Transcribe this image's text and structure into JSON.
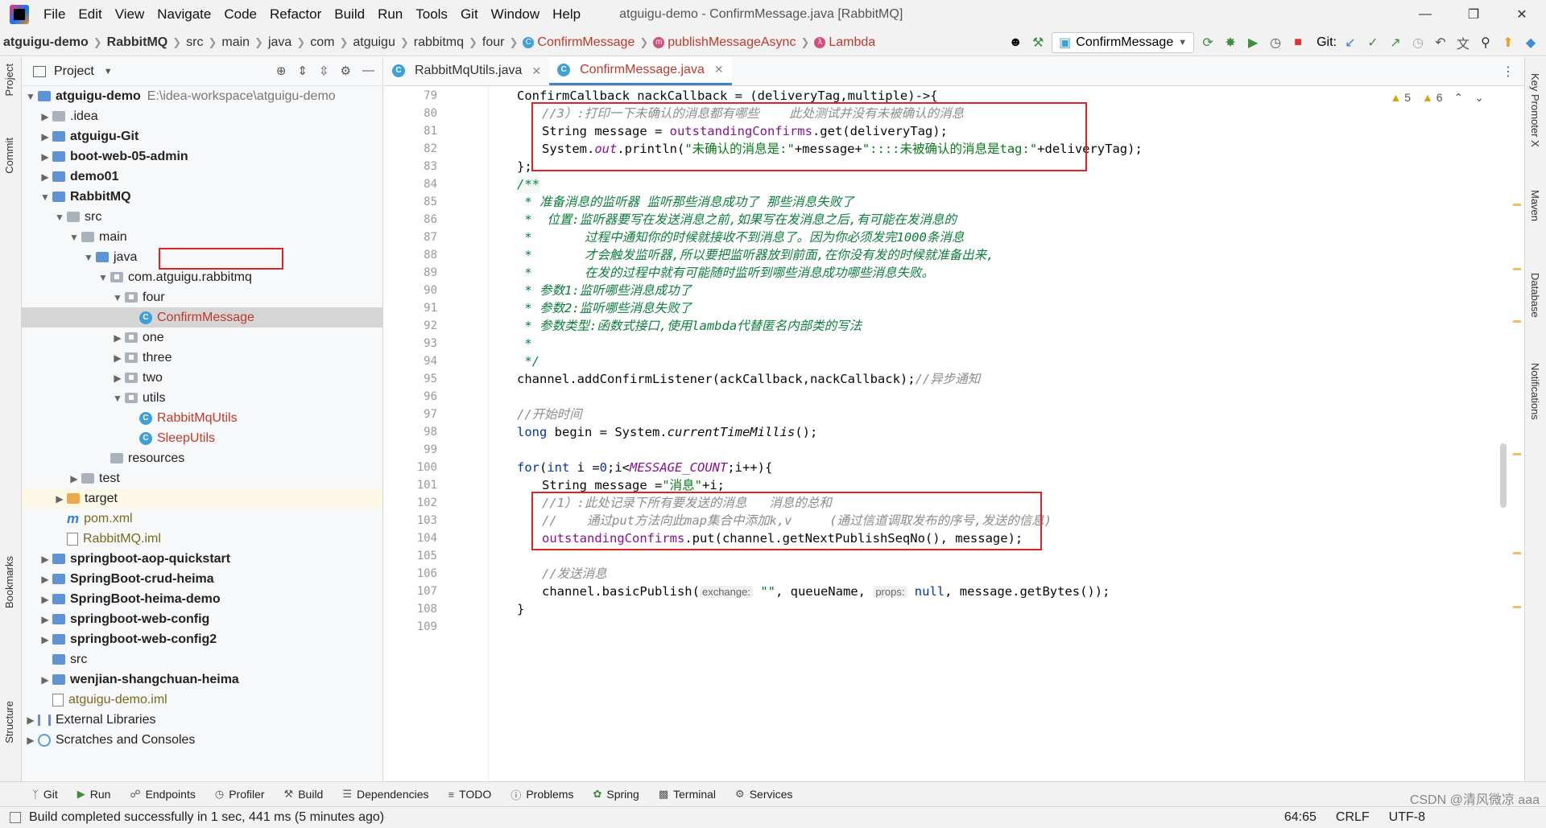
{
  "menubar": {
    "items": [
      "File",
      "Edit",
      "View",
      "Navigate",
      "Code",
      "Refactor",
      "Build",
      "Run",
      "Tools",
      "Git",
      "Window",
      "Help"
    ],
    "title": "atguigu-demo - ConfirmMessage.java [RabbitMQ]"
  },
  "navbar": {
    "crumbs": [
      "atguigu-demo",
      "RabbitMQ",
      "src",
      "main",
      "java",
      "com",
      "atguigu",
      "rabbitmq",
      "four",
      "ConfirmMessage",
      "publishMessageAsync",
      "Lambda"
    ],
    "run_config": "ConfirmMessage",
    "git_label": "Git:"
  },
  "left_strip": {
    "project": "Project",
    "commit": "Commit",
    "bookmarks": "Bookmarks",
    "structure": "Structure"
  },
  "right_strip": {
    "key_promoter": "Key Promoter X",
    "maven": "Maven",
    "database": "Database",
    "notifications": "Notifications"
  },
  "project_panel": {
    "title": "Project",
    "tree": [
      {
        "label": "atguigu-demo",
        "extra": "E:\\idea-workspace\\atguigu-demo"
      },
      {
        "label": ".idea"
      },
      {
        "label": "atguigu-Git"
      },
      {
        "label": "boot-web-05-admin"
      },
      {
        "label": "demo01"
      },
      {
        "label": "RabbitMQ"
      },
      {
        "label": "src"
      },
      {
        "label": "main"
      },
      {
        "label": "java"
      },
      {
        "label": "com.atguigu.rabbitmq"
      },
      {
        "label": "four"
      },
      {
        "label": "ConfirmMessage"
      },
      {
        "label": "one"
      },
      {
        "label": "three"
      },
      {
        "label": "two"
      },
      {
        "label": "utils"
      },
      {
        "label": "RabbitMqUtils"
      },
      {
        "label": "SleepUtils"
      },
      {
        "label": "resources"
      },
      {
        "label": "test"
      },
      {
        "label": "target"
      },
      {
        "label": "pom.xml"
      },
      {
        "label": "RabbitMQ.iml"
      },
      {
        "label": "springboot-aop-quickstart"
      },
      {
        "label": "SpringBoot-crud-heima"
      },
      {
        "label": "SpringBoot-heima-demo"
      },
      {
        "label": "springboot-web-config"
      },
      {
        "label": "springboot-web-config2"
      },
      {
        "label": "src"
      },
      {
        "label": "wenjian-shangchuan-heima"
      },
      {
        "label": "atguigu-demo.iml"
      },
      {
        "label": "External Libraries"
      },
      {
        "label": "Scratches and Consoles"
      }
    ]
  },
  "editor": {
    "tabs": [
      "RabbitMqUtils.java",
      "ConfirmMessage.java"
    ],
    "inspections": {
      "warnings": "5",
      "weak": "6"
    },
    "line_numbers": [
      "79",
      "80",
      "81",
      "82",
      "83",
      "84",
      "85",
      "86",
      "87",
      "88",
      "89",
      "90",
      "91",
      "92",
      "93",
      "94",
      "95",
      "96",
      "97",
      "98",
      "99",
      "100",
      "101",
      "102",
      "103",
      "104",
      "105",
      "106",
      "107",
      "108",
      "109"
    ],
    "code": {
      "l79_a": "ConfirmCallback nackCallback = (deliveryTag,multiple)->{",
      "l80": "//3）:打印一下未确认的消息都有哪些    此处测试并没有未被确认的消息",
      "l81_a": "String message = ",
      "l81_b": "outstandingConfirms",
      "l81_c": ".get(deliveryTag);",
      "l82_a": "System.",
      "l82_b": "out",
      "l82_c": ".println(",
      "l82_d": "\"未确认的消息是:\"",
      "l82_e": "+message+",
      "l82_f": "\"::::未被确认的消息是tag:\"",
      "l82_g": "+deliveryTag);",
      "l83": "};",
      "l84": "/**",
      "l85": " * 准备消息的监听器 监听那些消息成功了 那些消息失败了",
      "l86": " *  位置:监听器要写在发送消息之前,如果写在发消息之后,有可能在发消息的",
      "l87": " *       过程中通知你的时候就接收不到消息了。因为你必须发完1000条消息",
      "l88": " *       才会触发监听器,所以要把监听器放到前面,在你没有发的时候就准备出来,",
      "l89": " *       在发的过程中就有可能随时监听到哪些消息成功哪些消息失败。",
      "l90": " * 参数1:监听哪些消息成功了",
      "l91": " * 参数2:监听哪些消息失败了",
      "l92": " * 参数类型:函数式接口,使用lambda代替匿名内部类的写法",
      "l93": " *",
      "l94": " */",
      "l95_a": "channel.addConfirmListener(ackCallback,nackCallback);",
      "l95_b": "//异步通知",
      "l97": "//开始时间",
      "l98_a": "long",
      "l98_b": " begin = System.",
      "l98_c": "currentTimeMillis",
      "l98_d": "();",
      "l100_a": "for",
      "l100_b": "(",
      "l100_c": "int",
      "l100_d": " i =",
      "l100_e": "0",
      "l100_f": ";i<",
      "l100_g": "MESSAGE_COUNT",
      "l100_h": ";i++){",
      "l101_a": "String message =",
      "l101_b": "\"消息\"",
      "l101_c": "+i;",
      "l102": "//1）:此处记录下所有要发送的消息   消息的总和",
      "l103": "//    通过put方法向此map集合中添加k,v     (通过信道调取发布的序号,发送的信息)",
      "l104_a": "outstandingConfirms",
      "l104_b": ".put(channel.getNextPublishSeqNo(), message);",
      "l106": "//发送消息",
      "l107_a": "channel.basicPublish(",
      "l107_hint1": "exchange:",
      "l107_b": "\"\"",
      "l107_c": ", queueName, ",
      "l107_hint2": "props:",
      "l107_d": "null",
      "l107_e": ", message.getBytes());",
      "l108": "}"
    }
  },
  "bottom_tools": [
    "Git",
    "Run",
    "Endpoints",
    "Profiler",
    "Build",
    "Dependencies",
    "TODO",
    "Problems",
    "Spring",
    "Terminal",
    "Services"
  ],
  "status": {
    "message": "Build completed successfully in 1 sec, 441 ms (5 minutes ago)",
    "position": "64:65",
    "line_sep": "CRLF",
    "encoding": "UTF-8"
  },
  "watermark": "CSDN @清风微凉 aaa",
  "colors": {
    "accent": "#4083c9",
    "highlight_box": "#e02424",
    "string": "#067d17",
    "keyword": "#0033b3",
    "field": "#871094",
    "doc": "#0c7e3c"
  }
}
